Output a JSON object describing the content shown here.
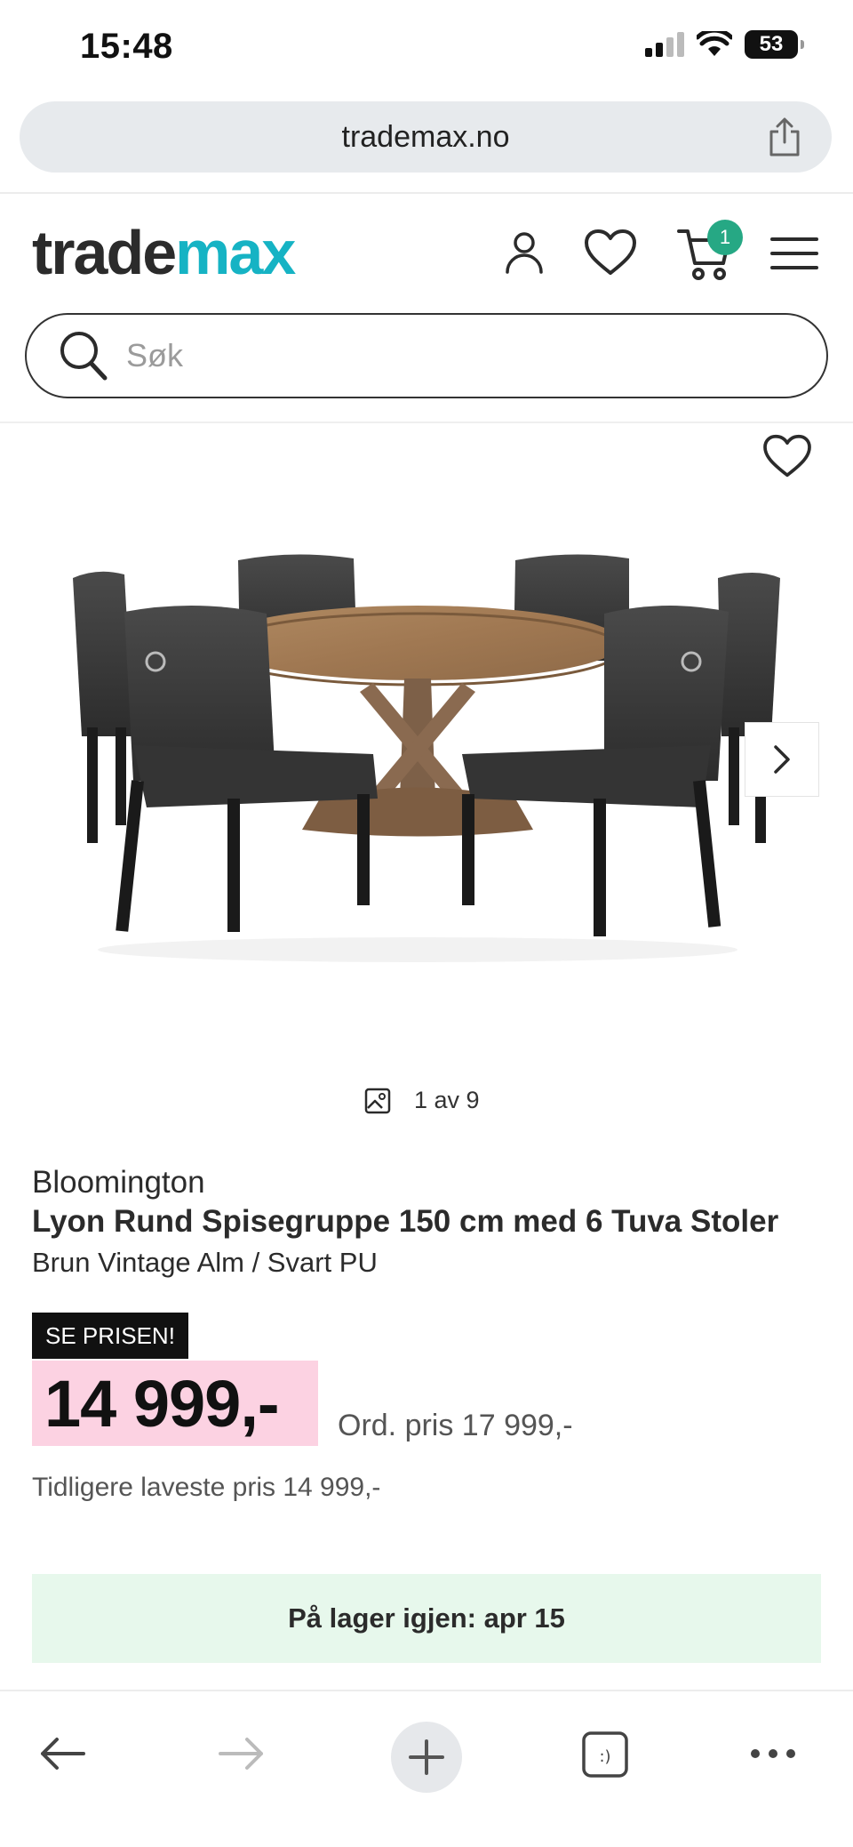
{
  "status_bar": {
    "time": "15:48",
    "battery": "53"
  },
  "browser": {
    "url": "trademax.no"
  },
  "site": {
    "logo_part1": "trade",
    "logo_part2": "max",
    "cart_count": "1",
    "search_placeholder": "Søk"
  },
  "gallery": {
    "counter": "1 av 9"
  },
  "product": {
    "brand": "Bloomington",
    "title": "Lyon Rund Spisegruppe 150 cm med 6 Tuva Stoler",
    "variant": "Brun Vintage Alm / Svart PU",
    "campaign_label": "SE PRISEN!",
    "price": "14 999,-",
    "ordinary_price": "Ord. pris 17 999,-",
    "lowest_price": "Tidligere laveste pris 14 999,-",
    "stock_status": "På lager igjen: apr 15"
  },
  "colors": {
    "accent": "#16b3c4",
    "badge": "#26a884",
    "price_bg": "#fcd2e2",
    "stock_bg": "#e7f8ec"
  }
}
